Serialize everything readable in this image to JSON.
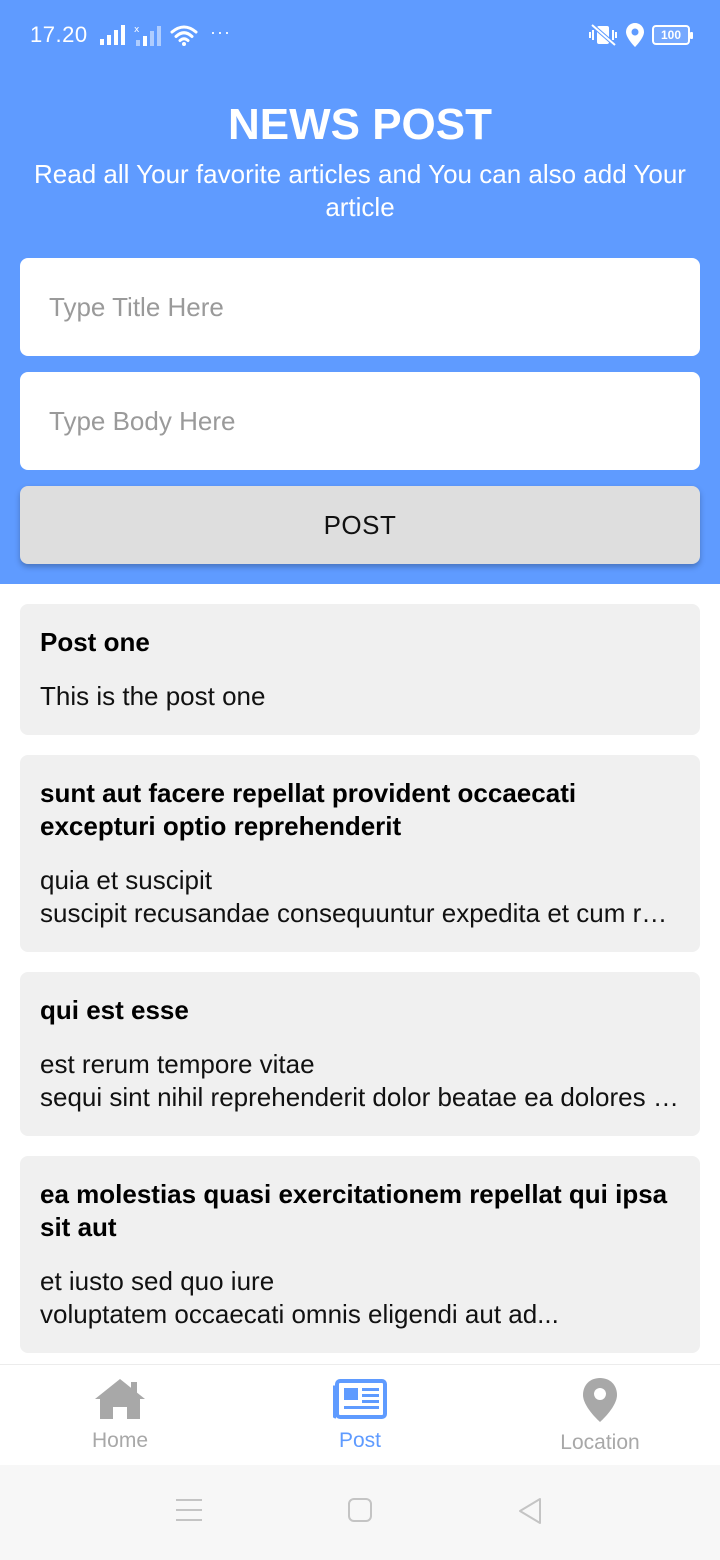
{
  "status_bar": {
    "time": "17.20",
    "dots": "···",
    "battery": "100"
  },
  "header": {
    "title": "NEWS POST",
    "subtitle": "Read all Your favorite articles and You can also add Your article"
  },
  "form": {
    "title_placeholder": "Type Title Here",
    "body_placeholder": "Type Body Here",
    "post_button": "POST"
  },
  "posts": [
    {
      "title": "Post one",
      "body_lines": [
        "This is the post one"
      ]
    },
    {
      "title": "sunt aut facere repellat provident occaecati excepturi optio reprehenderit",
      "body_lines": [
        "quia et suscipit",
        "suscipit recusandae consequuntur expedita et cum reprehenderit molestiae ut ut quas totam"
      ]
    },
    {
      "title": "qui est esse",
      "body_lines": [
        "est rerum tempore vitae",
        "sequi sint nihil reprehenderit dolor beatae ea dolores neque"
      ]
    },
    {
      "title": "ea molestias quasi exercitationem repellat qui ipsa sit aut",
      "body_lines": [
        "et iusto sed quo iure",
        "voluptatem occaecati omnis eligendi aut ad..."
      ]
    }
  ],
  "bottom_nav": {
    "items": [
      {
        "label": "Home",
        "icon": "home-icon",
        "active": false
      },
      {
        "label": "Post",
        "icon": "newspaper-icon",
        "active": true
      },
      {
        "label": "Location",
        "icon": "location-pin-icon",
        "active": false
      }
    ]
  },
  "colors": {
    "accent": "#5f9bff",
    "card_bg": "#f0f0f0",
    "inactive": "#a8a8a8"
  }
}
